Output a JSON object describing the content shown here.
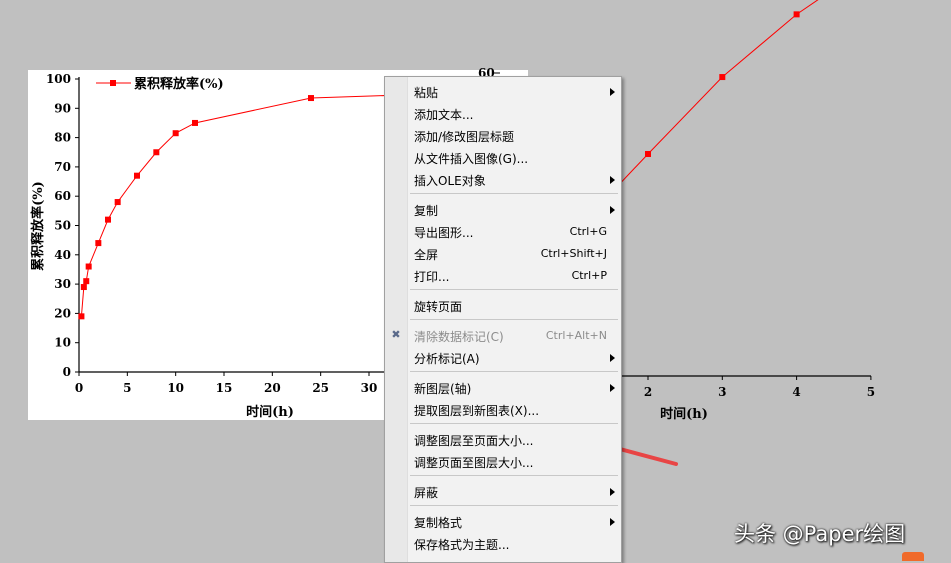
{
  "graph1": {
    "ylabel": "累积释放率(%)",
    "xlabel": "时间(h)",
    "legend": "累积释放率(%)",
    "xticks": [
      0,
      5,
      10,
      15,
      20,
      25,
      30
    ],
    "yticks": [
      0,
      10,
      20,
      30,
      40,
      50,
      60,
      70,
      80,
      90,
      100
    ]
  },
  "graph2": {
    "xlabel": "时间(h)",
    "xticks": [
      2,
      3,
      4,
      5
    ],
    "ytick_top": "60"
  },
  "chart_data": [
    {
      "type": "line",
      "title": "",
      "xlabel": "时间(h)",
      "ylabel": "累积释放率(%)",
      "xlim": [
        0,
        35
      ],
      "ylim": [
        0,
        100
      ],
      "legend_placement": "top-left",
      "color": "#ff0000",
      "series": [
        {
          "name": "累积释放率(%)",
          "x": [
            0.25,
            0.5,
            0.75,
            1,
            2,
            3,
            4,
            6,
            8,
            10,
            12,
            24,
            33
          ],
          "y": [
            19,
            29,
            31,
            36,
            44,
            52,
            58,
            67,
            75,
            81.5,
            85,
            93.5,
            94.5
          ]
        }
      ]
    },
    {
      "type": "line",
      "xlabel": "时间(h)",
      "xlim": [
        1.3,
        5
      ],
      "color": "#ff0000",
      "series": [
        {
          "x": [
            1.6,
            2,
            3,
            4,
            4.45
          ],
          "y": [
            69,
            74.5,
            88,
            99,
            103
          ]
        }
      ]
    }
  ],
  "context_menu": {
    "items": [
      {
        "label": "粘贴",
        "shortcut": "",
        "submenu": true
      },
      {
        "label": "添加文本...",
        "shortcut": "",
        "submenu": false
      },
      {
        "label": "添加/修改图层标题",
        "shortcut": "",
        "submenu": false
      },
      {
        "label": "从文件插入图像(G)...",
        "shortcut": "",
        "submenu": false
      },
      {
        "label": "插入OLE对象",
        "shortcut": "",
        "submenu": true
      },
      {
        "label": "复制",
        "shortcut": "",
        "submenu": true
      },
      {
        "label": "导出图形...",
        "shortcut": "Ctrl+G",
        "submenu": false
      },
      {
        "label": "全屏",
        "shortcut": "Ctrl+Shift+J",
        "submenu": false
      },
      {
        "label": "打印...",
        "shortcut": "Ctrl+P",
        "submenu": false
      },
      {
        "label": "旋转页面",
        "shortcut": "",
        "submenu": false
      },
      {
        "label": "清除数据标记(C)",
        "shortcut": "Ctrl+Alt+N",
        "submenu": false,
        "disabled": true
      },
      {
        "label": "分析标记(A)",
        "shortcut": "",
        "submenu": true
      },
      {
        "label": "新图层(轴)",
        "shortcut": "",
        "submenu": true
      },
      {
        "label": "提取图层到新图表(X)...",
        "shortcut": "",
        "submenu": false
      },
      {
        "label": "调整图层至页面大小...",
        "shortcut": "",
        "submenu": false
      },
      {
        "label": "调整页面至图层大小...",
        "shortcut": "",
        "submenu": false
      },
      {
        "label": "屏蔽",
        "shortcut": "",
        "submenu": true
      },
      {
        "label": "复制格式",
        "shortcut": "",
        "submenu": true
      },
      {
        "label": "保存格式为主题...",
        "shortcut": "",
        "submenu": false
      }
    ]
  },
  "watermark": "头条 @Paper绘图",
  "colors": {
    "background": "#c0c0c0",
    "series": "#ff0000",
    "arrow": "#e84545",
    "menu_bg": "#f2f2f2"
  }
}
